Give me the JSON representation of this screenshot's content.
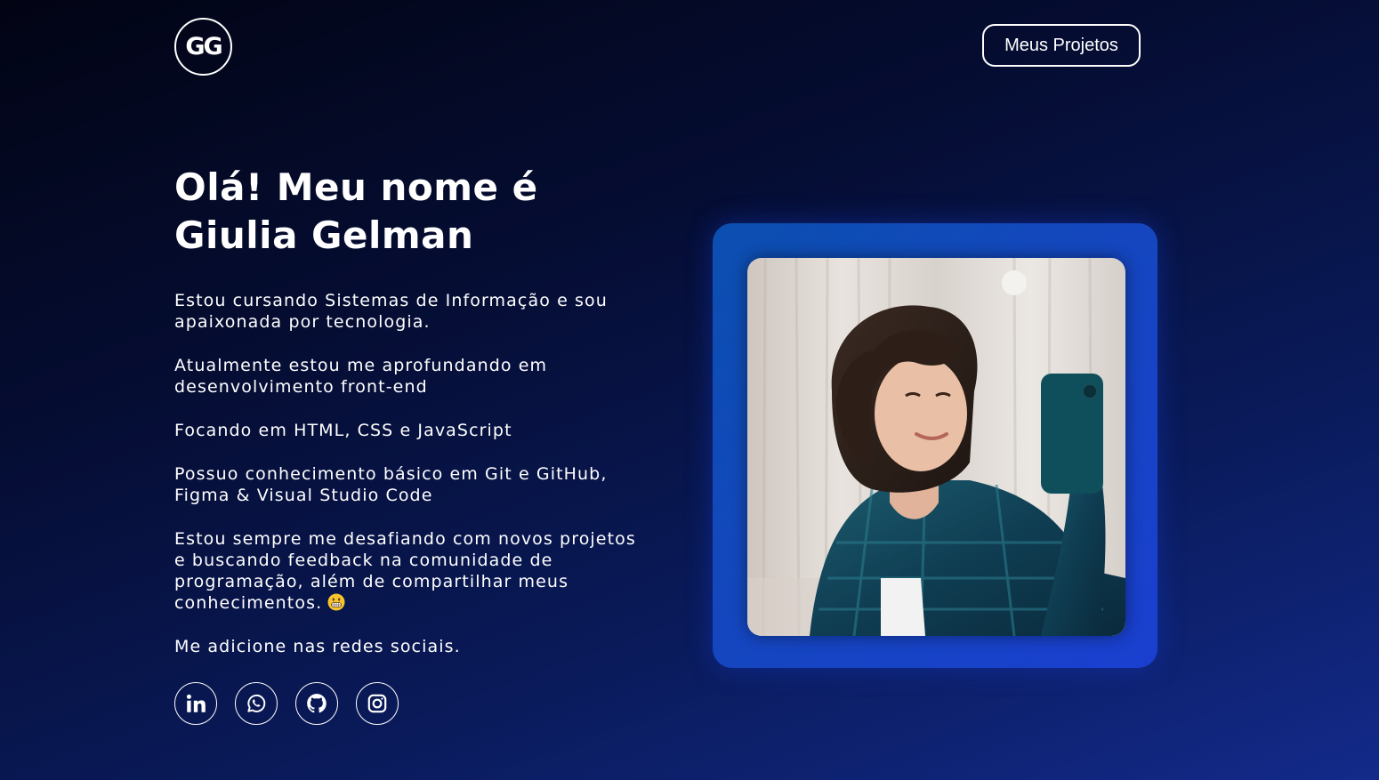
{
  "header": {
    "logo_text": "GG",
    "projects_button": "Meus Projetos"
  },
  "hero": {
    "title_line1": "Olá! Meu nome é",
    "title_line2": "Giulia Gelman"
  },
  "bio": {
    "paragraphs": [
      "Estou cursando Sistemas de Informação e sou apaixonada por tecnologia.",
      "Atualmente estou me aprofundando em desenvolvimento front-end",
      "Focando em HTML, CSS e JavaScript",
      "Possuo conhecimento básico em Git e GitHub, Figma & Visual Studio Code",
      "Estou sempre me desafiando com novos projetos e buscando feedback na comunidade de programação, além de compartilhar meus conhecimentos.",
      "Me adicione nas redes sociais."
    ]
  },
  "socials": [
    {
      "icon": "linkedin-icon"
    },
    {
      "icon": "whatsapp-icon"
    },
    {
      "icon": "github-icon"
    },
    {
      "icon": "instagram-icon"
    }
  ],
  "colors": {
    "frame_blue": "#1546c0",
    "background_dark": "#020414",
    "background_blue": "#132a8a"
  }
}
